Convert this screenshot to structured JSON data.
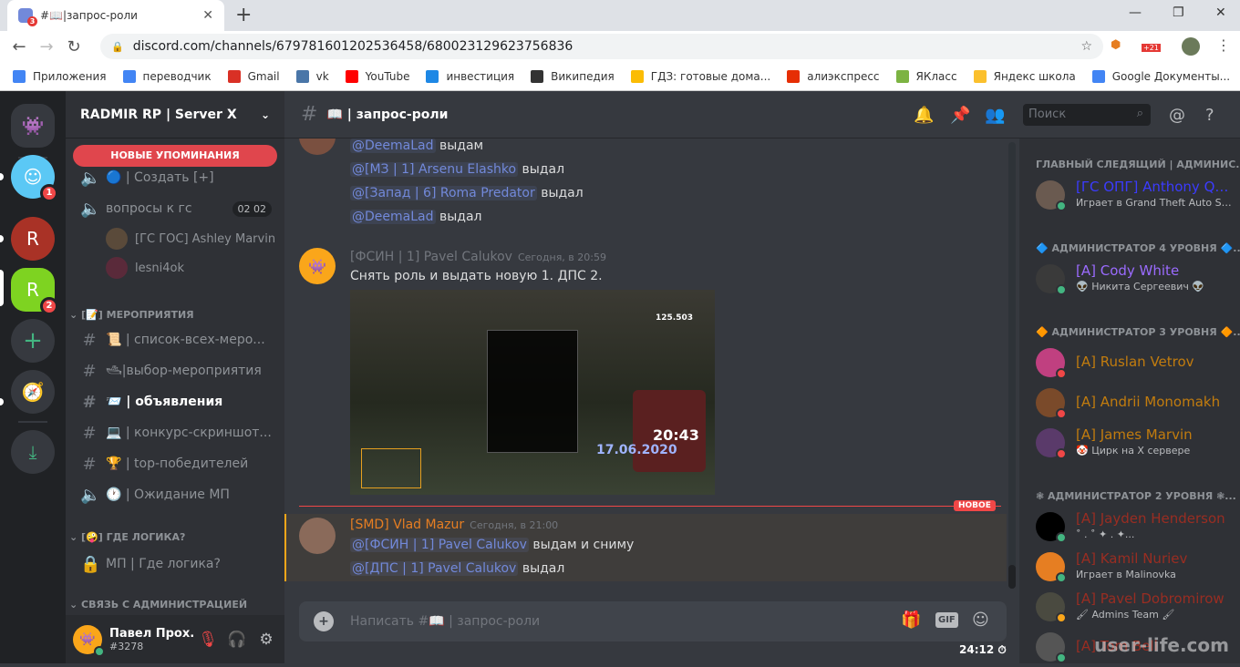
{
  "browser": {
    "tab_title": "#📖|запрос-роли",
    "tab_badge": "3",
    "url": "discord.com/channels/679781601202536458/680023129623756836",
    "ext_badge": "+21",
    "bookmarks": [
      {
        "label": "Приложения",
        "color": "#4285f4"
      },
      {
        "label": "переводчик",
        "color": "#4285f4"
      },
      {
        "label": "Gmail",
        "color": "#d93025"
      },
      {
        "label": "vk",
        "color": "#4a76a8"
      },
      {
        "label": "YouTube",
        "color": "#ff0000"
      },
      {
        "label": "инвестиция",
        "color": "#1e88e5"
      },
      {
        "label": "Википедия",
        "color": "#333333"
      },
      {
        "label": "ГДЗ: готовые дома...",
        "color": "#fbbc05"
      },
      {
        "label": "алиэкспресс",
        "color": "#e62e04"
      },
      {
        "label": "ЯКласс",
        "color": "#7cb342"
      },
      {
        "label": "Яндекс школа",
        "color": "#fbc02d"
      },
      {
        "label": "Google Документы...",
        "color": "#4285f4"
      }
    ]
  },
  "servers": [
    {
      "badge": "1",
      "color": "#5bc8f5"
    },
    {
      "badge": "",
      "color": "#c0392b"
    },
    {
      "badge": "2",
      "color": "#7ed321"
    }
  ],
  "guild": {
    "name": "RADMIR RP | Server X"
  },
  "new_mentions": "НОВЫЕ УПОМИНАНИЯ",
  "channels": {
    "top": [
      {
        "label": "🔵 | Создать [+]",
        "type": "voice"
      },
      {
        "label": "вопросы к гс",
        "type": "voice",
        "count_a": "02",
        "count_b": "02"
      }
    ],
    "voice_users": [
      "[ГС ГОС] Ashley Marvin",
      "lesni4ok"
    ],
    "cat1": "[📝] МЕРОПРИЯТИЯ",
    "cat1_items": [
      {
        "label": "📜 | список-всех-меро...",
        "type": "text"
      },
      {
        "label": "🛥|выбор-мероприятия",
        "type": "text"
      },
      {
        "label": "📨 | объявления",
        "type": "text",
        "active": true
      },
      {
        "label": "💻 | конкурс-скриншот...",
        "type": "text"
      },
      {
        "label": "🏆 | top-победителей",
        "type": "text"
      },
      {
        "label": "🕐 | Ожидание МП",
        "type": "voice"
      }
    ],
    "cat2": "[🤪] ГДЕ ЛОГИКА?",
    "cat2_items": [
      {
        "label": "МП | Где логика?",
        "type": "locked"
      }
    ],
    "cat3": "СВЯЗЬ С АДМИНИСТРАЦИЕЙ"
  },
  "user": {
    "name": "Павел Прох...",
    "tag": "#3278"
  },
  "header": {
    "channel": "📖 | запрос-роли",
    "search_placeholder": "Поиск"
  },
  "messages": {
    "cont": [
      {
        "mention": "@DeemaLad",
        "text": "выдам"
      },
      {
        "mention": "@[МЗ | 1] Arsenu Elashko",
        "text": "выдал"
      },
      {
        "mention": "@[Запад | 6] Roma Predator",
        "text": "выдал"
      },
      {
        "mention": "@DeemaLad",
        "text": "выдал"
      }
    ],
    "m1": {
      "author": "[ФСИН | 1] Pavel Calukov",
      "time": "Сегодня, в 20:59",
      "text": "Снять роль и выдать новую 1. ДПС 2.",
      "shot_time": "20:43",
      "shot_date": "17.06.2020",
      "shot_money": "125.503"
    },
    "new_label": "НОВОЕ",
    "m2": {
      "author": "[SMD] Vlad Mazur",
      "time": "Сегодня, в 21:00",
      "author_color": "#e67e22",
      "lines": [
        {
          "mention": "@[ФСИН | 1] Pavel Calukov",
          "text": "выдам и сниму"
        },
        {
          "mention": "@[ДПС | 1] Pavel Calukov",
          "text": "выдал"
        }
      ]
    }
  },
  "composer": {
    "placeholder": "Написать #📖 | запрос-роли",
    "gif": "GIF"
  },
  "timer": "24:12",
  "members": [
    {
      "cat": "ГЛАВНЫЙ СЛЕДЯЩИЙ | АДМИНИС...",
      "items": [
        {
          "name": "[ГС ОПГ] Anthony Qu...",
          "color": "#3b3bff",
          "status": "Играет в Grand Theft Auto Sa...",
          "presence": "online"
        }
      ]
    },
    {
      "cat": "🔷 АДМИНИСТРАТОР 4 УРОВНЯ 🔷...",
      "items": [
        {
          "name": "[A] Cody White",
          "color": "#9b6bff",
          "status": "👽 Никита Сергеевич 👽",
          "presence": "online"
        }
      ]
    },
    {
      "cat": "🔶 АДМИНИСТРАТОР 3 УРОВНЯ 🔶...",
      "items": [
        {
          "name": "[A] Ruslan Vetrov",
          "color": "#c27c0e",
          "status": "",
          "presence": "dnd"
        },
        {
          "name": "[A] Andrii Monomakh",
          "color": "#c27c0e",
          "status": "",
          "presence": "dnd"
        },
        {
          "name": "[A] James Marvin",
          "color": "#c27c0e",
          "status": "🤡 Цирк на X сервере",
          "presence": "dnd"
        }
      ]
    },
    {
      "cat": "❃ АДМИНИСТРАТОР 2 УРОВНЯ ❃...",
      "items": [
        {
          "name": "[A] Jayden Henderson",
          "color": "#992d22",
          "status": "˚ . ˚ ✦ . ✦...",
          "presence": "online"
        },
        {
          "name": "[A] Kamil Nuriev",
          "color": "#992d22",
          "status": "Играет в Malinovka",
          "presence": "online"
        },
        {
          "name": "[A] Pavel Dobromirow",
          "color": "#992d22",
          "status": "🖌 Admins Team 🖌",
          "presence": "idle"
        },
        {
          "name": "[A] Tom Bell",
          "color": "#992d22",
          "status": "",
          "presence": "online"
        }
      ]
    }
  ],
  "watermark": "user-life.com",
  "colors": {
    "accent": "#7289da",
    "mention_bg": "#e0464d",
    "online": "#43b581",
    "dnd": "#f04747",
    "idle": "#faa61a"
  }
}
